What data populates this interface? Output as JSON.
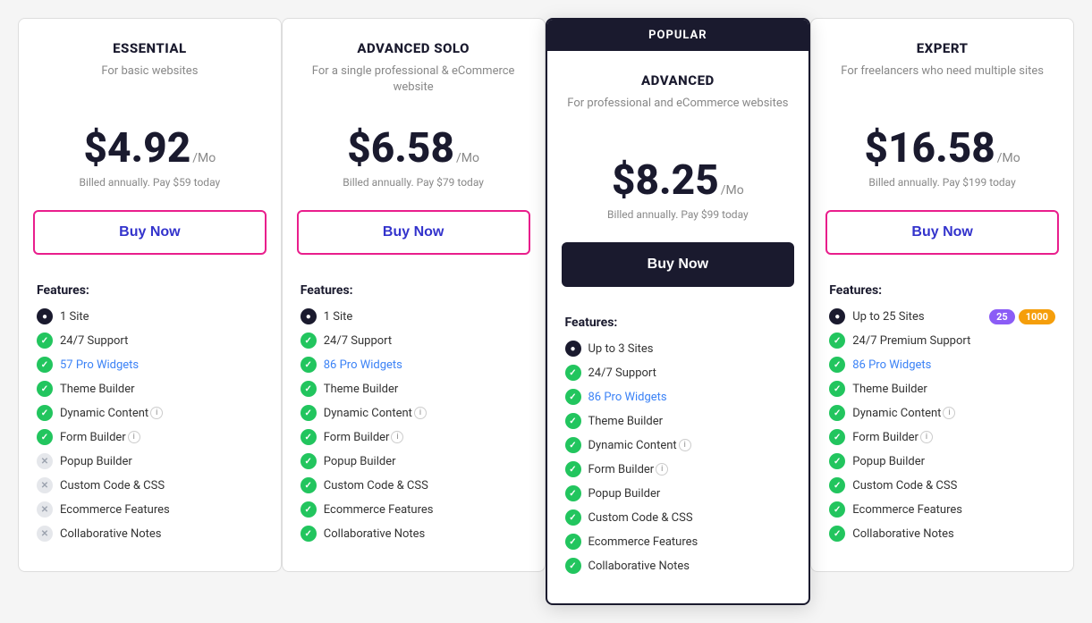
{
  "plans": [
    {
      "id": "essential",
      "name": "ESSENTIAL",
      "desc": "For basic websites",
      "price": "$4.92",
      "per": "/Mo",
      "billing": "Billed annually. Pay $59 today",
      "buyLabel": "Buy Now",
      "btnStyle": "outline",
      "popular": false,
      "features_title": "Features:",
      "features": [
        {
          "icon": "navy",
          "text": "1 Site",
          "link": false
        },
        {
          "icon": "green",
          "text": "24/7 Support",
          "link": false
        },
        {
          "icon": "green",
          "text": "57 Pro Widgets",
          "link": true
        },
        {
          "icon": "green",
          "text": "Theme Builder",
          "link": false
        },
        {
          "icon": "green",
          "text": "Dynamic Content",
          "link": false,
          "info": true
        },
        {
          "icon": "green",
          "text": "Form Builder",
          "link": false,
          "info": true
        },
        {
          "icon": "gray",
          "text": "Popup Builder",
          "link": false
        },
        {
          "icon": "gray",
          "text": "Custom Code & CSS",
          "link": false
        },
        {
          "icon": "gray",
          "text": "Ecommerce Features",
          "link": false
        },
        {
          "icon": "gray",
          "text": "Collaborative Notes",
          "link": false
        }
      ]
    },
    {
      "id": "advanced-solo",
      "name": "ADVANCED SOLO",
      "desc": "For a single professional & eCommerce website",
      "price": "$6.58",
      "per": "/Mo",
      "billing": "Billed annually. Pay $79 today",
      "buyLabel": "Buy Now",
      "btnStyle": "outline",
      "popular": false,
      "features_title": "Features:",
      "features": [
        {
          "icon": "navy",
          "text": "1 Site",
          "link": false
        },
        {
          "icon": "green",
          "text": "24/7 Support",
          "link": false
        },
        {
          "icon": "green",
          "text": "86 Pro Widgets",
          "link": true
        },
        {
          "icon": "green",
          "text": "Theme Builder",
          "link": false
        },
        {
          "icon": "green",
          "text": "Dynamic Content",
          "link": false,
          "info": true
        },
        {
          "icon": "green",
          "text": "Form Builder",
          "link": false,
          "info": true
        },
        {
          "icon": "green",
          "text": "Popup Builder",
          "link": false
        },
        {
          "icon": "green",
          "text": "Custom Code & CSS",
          "link": false
        },
        {
          "icon": "green",
          "text": "Ecommerce Features",
          "link": false
        },
        {
          "icon": "green",
          "text": "Collaborative Notes",
          "link": false
        }
      ]
    },
    {
      "id": "advanced",
      "name": "ADVANCED",
      "desc": "For professional and eCommerce websites",
      "price": "$8.25",
      "per": "/Mo",
      "billing": "Billed annually. Pay $99 today",
      "buyLabel": "Buy Now",
      "btnStyle": "filled",
      "popular": true,
      "popular_label": "POPULAR",
      "features_title": "Features:",
      "features": [
        {
          "icon": "navy",
          "text": "Up to 3 Sites",
          "link": false
        },
        {
          "icon": "green",
          "text": "24/7 Support",
          "link": false
        },
        {
          "icon": "green",
          "text": "86 Pro Widgets",
          "link": true
        },
        {
          "icon": "green",
          "text": "Theme Builder",
          "link": false
        },
        {
          "icon": "green",
          "text": "Dynamic Content",
          "link": false,
          "info": true
        },
        {
          "icon": "green",
          "text": "Form Builder",
          "link": false,
          "info": true
        },
        {
          "icon": "green",
          "text": "Popup Builder",
          "link": false
        },
        {
          "icon": "green",
          "text": "Custom Code & CSS",
          "link": false
        },
        {
          "icon": "green",
          "text": "Ecommerce Features",
          "link": false
        },
        {
          "icon": "green",
          "text": "Collaborative Notes",
          "link": false
        }
      ]
    },
    {
      "id": "expert",
      "name": "EXPERT",
      "desc": "For freelancers who need multiple sites",
      "price": "$16.58",
      "per": "/Mo",
      "billing": "Billed annually. Pay $199 today",
      "buyLabel": "Buy Now",
      "btnStyle": "outline",
      "popular": false,
      "features_title": "Features:",
      "features": [
        {
          "icon": "navy",
          "text": "Up to 25 Sites",
          "link": false,
          "badges": [
            "25",
            "1000"
          ]
        },
        {
          "icon": "green",
          "text": "24/7 Premium Support",
          "link": false
        },
        {
          "icon": "green",
          "text": "86 Pro Widgets",
          "link": true
        },
        {
          "icon": "green",
          "text": "Theme Builder",
          "link": false
        },
        {
          "icon": "green",
          "text": "Dynamic Content",
          "link": false,
          "info": true
        },
        {
          "icon": "green",
          "text": "Form Builder",
          "link": false,
          "info": true
        },
        {
          "icon": "green",
          "text": "Popup Builder",
          "link": false
        },
        {
          "icon": "green",
          "text": "Custom Code & CSS",
          "link": false
        },
        {
          "icon": "green",
          "text": "Ecommerce Features",
          "link": false
        },
        {
          "icon": "green",
          "text": "Collaborative Notes",
          "link": false
        }
      ]
    }
  ]
}
